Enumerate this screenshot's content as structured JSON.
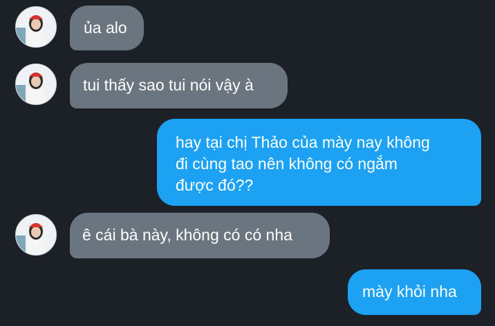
{
  "messages": [
    {
      "sender": "other",
      "text": "ủa alo"
    },
    {
      "sender": "other",
      "text": "tui thấy sao tui nói vậy à"
    },
    {
      "sender": "me",
      "lines": [
        "hay tại chị Thảo của mày nay không",
        "đi cùng tao nên không có ngắm",
        "được đó??"
      ]
    },
    {
      "sender": "other",
      "text": "ê cái bà này, không có có nha"
    },
    {
      "sender": "me",
      "text": "mày khỏi nha"
    }
  ],
  "colors": {
    "background": "#1c2128",
    "incoming_bubble": "#6a7580",
    "outgoing_bubble": "#1da1f2",
    "text": "#ffffff"
  },
  "icons": {
    "avatar": "avatar"
  }
}
